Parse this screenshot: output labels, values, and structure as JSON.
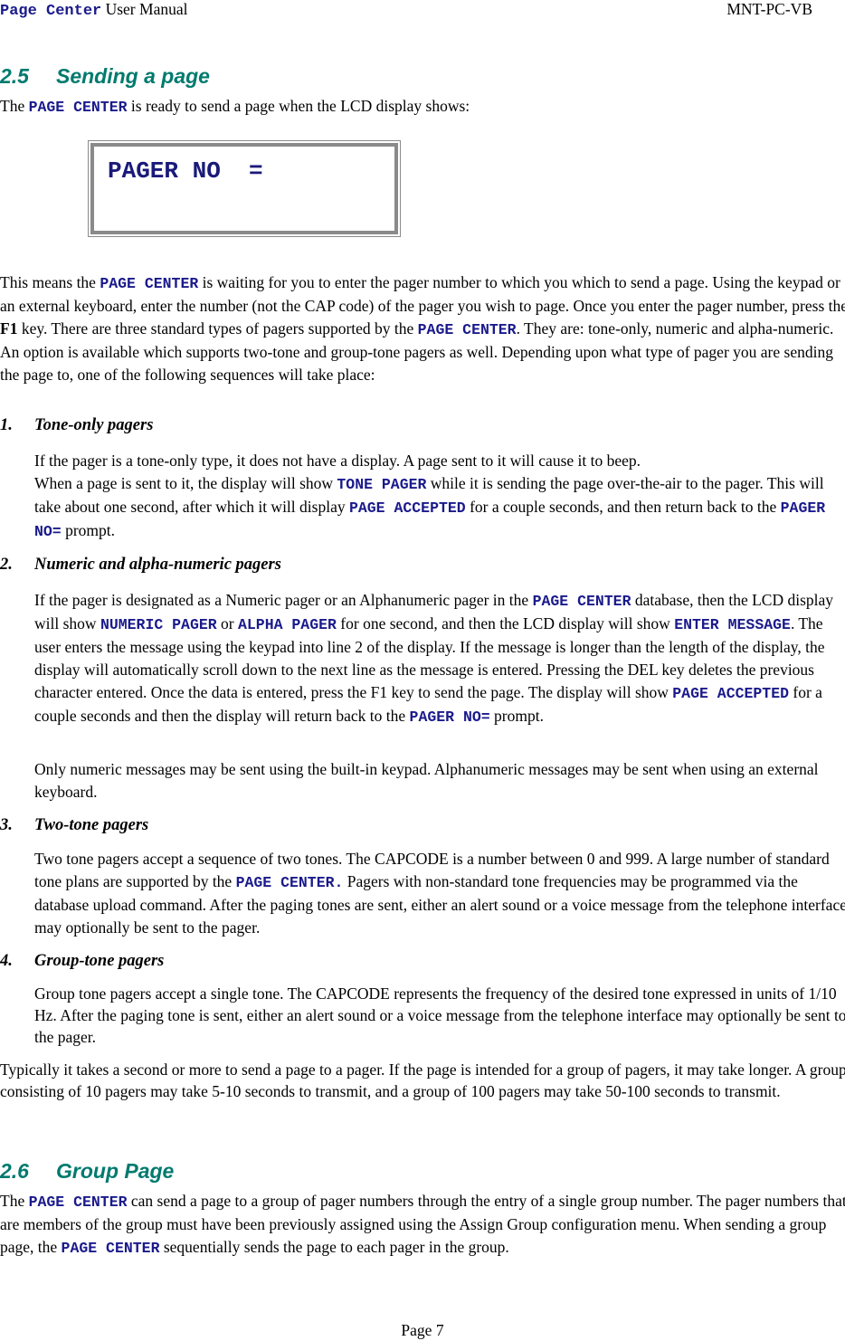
{
  "header": {
    "product": "Page Center",
    "left_rest": " User Manual",
    "doc_code": "MNT-PC-VB"
  },
  "colors": {
    "heading": "#007a6e",
    "code_text": "#1a1a8c",
    "lcd_border": "#8a8a8a"
  },
  "section_2_5": {
    "number": "2.5",
    "title": "Sending a page",
    "intro": [
      {
        "t": "The "
      },
      {
        "t": "PAGE CENTER",
        "c": "mono"
      },
      {
        "t": " is ready to send a page when the LCD display shows:"
      }
    ],
    "lcd_display": {
      "line1": "PAGER NO  =",
      "line2": ""
    },
    "body": [
      {
        "t": "This means the "
      },
      {
        "t": "PAGE CENTER",
        "c": "mono"
      },
      {
        "t": " is waiting for you to enter the pager number to which you which to send a page.  Using the keypad or an external keyboard, enter the number (not the CAP code) of the pager you wish to page.  Once you enter the pager number, press the "
      },
      {
        "t": "F1",
        "c": "bold"
      },
      {
        "t": " key.  There are three standard types of pagers supported by the "
      },
      {
        "t": "PAGE CENTER",
        "c": "mono"
      },
      {
        "t": ". They are: tone-only, numeric and alpha-numeric.  An option is available which supports two-tone and group-tone pagers as well.  Depending upon what type of pager you are sending the page to, one of the following sequences will take place:"
      }
    ],
    "items": [
      {
        "number": "1.",
        "title": "Tone-only pagers",
        "paragraphs": [
          [
            {
              "t": "If the pager is a tone-only type, it does not have a display. A page sent to it will cause it to beep."
            },
            {
              "br": true
            },
            {
              "t": "When a page is sent to it, the display will show "
            },
            {
              "t": "TONE PAGER",
              "c": "mono"
            },
            {
              "t": "  while it is sending the page over-the-air to the pager.  This will take about one second, after which it will display  "
            },
            {
              "t": "PAGE ACCEPTED",
              "c": "mono"
            },
            {
              "t": " for a couple seconds, and then return back to the  "
            },
            {
              "t": "PAGER NO=",
              "c": "mono"
            },
            {
              "t": " prompt."
            }
          ]
        ]
      },
      {
        "number": "2.",
        "title": "Numeric and alpha-numeric pagers",
        "paragraphs": [
          [
            {
              "t": "If the pager is designated as a Numeric pager or an Alphanumeric pager in the "
            },
            {
              "t": "PAGE CENTER",
              "c": "mono"
            },
            {
              "t": " database, then the LCD display will show "
            },
            {
              "t": "NUMERIC PAGER",
              "c": "mono"
            },
            {
              "t": "  or "
            },
            {
              "t": "ALPHA PAGER",
              "c": "mono"
            },
            {
              "t": "  for one second, and then the LCD display will show "
            },
            {
              "t": "ENTER MESSAGE",
              "c": "mono"
            },
            {
              "t": ".  The user enters the message using the keypad into line 2 of the display.  If the message is longer than the length of the display, the display will automatically scroll down to the next line as the message is entered.  Pressing the DEL key deletes the previous character entered.  Once the data is entered, press the F1 key to send the page.  The display will show "
            },
            {
              "t": "PAGE ACCEPTED",
              "c": "mono"
            },
            {
              "t": " for a couple seconds and then the display will return back to the  "
            },
            {
              "t": "PAGER NO=",
              "c": "mono"
            },
            {
              "t": " prompt."
            }
          ],
          [
            {
              "t": "Only numeric messages may be sent using the built-in keypad.  Alphanumeric messages may be sent when using an external keyboard."
            }
          ]
        ]
      },
      {
        "number": "3.",
        "title": "Two-tone pagers",
        "paragraphs": [
          [
            {
              "t": "Two tone pagers accept a sequence of two tones.  The CAPCODE is a number between 0 and 999.  A large number of standard tone plans are supported by the "
            },
            {
              "t": "PAGE CENTER.",
              "c": "mono"
            },
            {
              "t": "    Pagers with non-standard tone frequencies may be programmed via the database upload command.  After the paging tones are sent, either an alert sound or a voice message from the telephone interface may optionally be sent to the pager."
            }
          ]
        ]
      },
      {
        "number": "4.",
        "title": "Group-tone pagers",
        "paragraphs": [
          [
            {
              "t": "Group tone pagers accept a single tone.  The CAPCODE represents the frequency of the desired tone expressed in units of 1/10 Hz. After the paging tone is sent, either an alert sound or a voice message from the telephone interface may optionally be sent to the pager."
            }
          ]
        ]
      }
    ],
    "closing": [
      {
        "t": "Typically it takes a second or more to send a page to a pager. If the page is intended for a group of pagers, it may take longer.  A group consisting of 10 pagers may take 5-10 seconds to transmit, and a group of 100 pagers may take 50-100 seconds to transmit."
      }
    ]
  },
  "section_2_6": {
    "number": "2.6",
    "title": "Group Page",
    "body": [
      {
        "t": "The "
      },
      {
        "t": "PAGE CENTER",
        "c": "mono"
      },
      {
        "t": " can send a page to a group of pager numbers through the entry of a single group number. The pager numbers that are members of the group must have been previously assigned using the Assign Group configuration menu.  When sending a group page, the "
      },
      {
        "t": "PAGE CENTER",
        "c": "mono"
      },
      {
        "t": " sequentially sends the page to each pager in the group."
      }
    ]
  },
  "footer": {
    "page_label": "Page 7"
  }
}
